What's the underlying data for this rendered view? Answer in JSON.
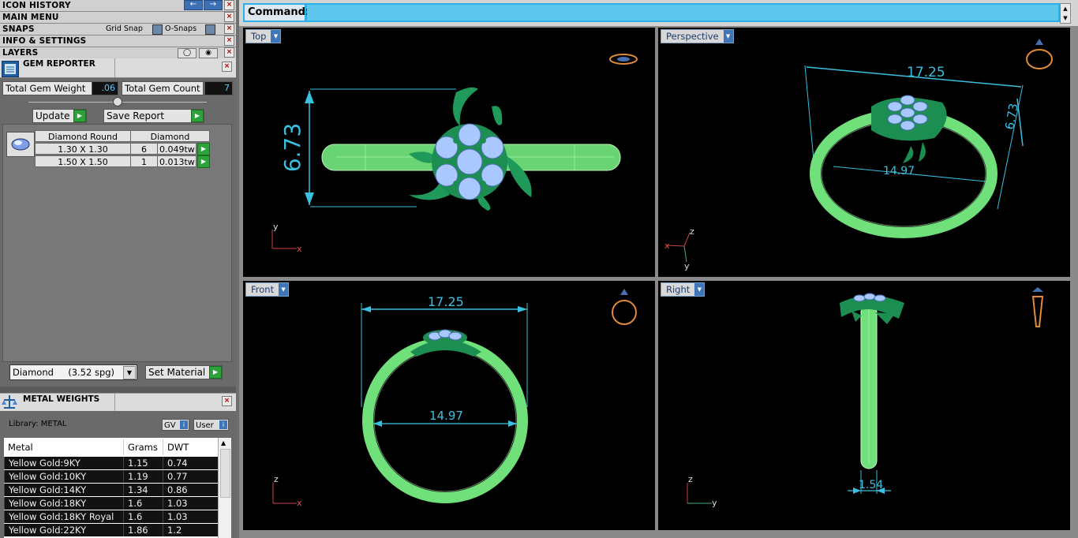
{
  "left_panel": {
    "menus": [
      {
        "label": "ICON HISTORY"
      },
      {
        "label": "MAIN MENU"
      },
      {
        "label": "SNAPS"
      },
      {
        "label": "INFO & SETTINGS"
      },
      {
        "label": "LAYERS"
      }
    ],
    "snaps": {
      "grid_snap": "Grid Snap",
      "o_snaps": "O-Snaps"
    },
    "gem_reporter": {
      "title": "GEM REPORTER",
      "total_weight_label": "Total Gem Weight",
      "total_weight_value": ".06",
      "total_count_label": "Total Gem Count",
      "total_count_value": "7",
      "update_label": "Update",
      "save_report_label": "Save Report",
      "table_header": {
        "shape": "Diamond Round",
        "material": "Diamond"
      },
      "rows": [
        {
          "size": "1.30 X 1.30",
          "count": "6",
          "weight": "0.049tw"
        },
        {
          "size": "1.50 X 1.50",
          "count": "1",
          "weight": "0.013tw"
        }
      ],
      "material_select": "Diamond     (3.52 spg)",
      "set_material_label": "Set Material"
    },
    "metal_weights": {
      "title": "METAL WEIGHTS",
      "library": "Library: METAL",
      "gv_label": "GV",
      "user_label": "User",
      "columns": [
        "Metal",
        "Grams",
        "DWT"
      ],
      "rows": [
        {
          "metal": "Yellow Gold:9KY",
          "grams": "1.15",
          "dwt": "0.74"
        },
        {
          "metal": "Yellow Gold:10KY",
          "grams": "1.19",
          "dwt": "0.77"
        },
        {
          "metal": "Yellow Gold:14KY",
          "grams": "1.34",
          "dwt": "0.86"
        },
        {
          "metal": "Yellow Gold:18KY",
          "grams": "1.6",
          "dwt": "1.03"
        },
        {
          "metal": "Yellow Gold:18KY Royal",
          "grams": "1.6",
          "dwt": "1.03"
        },
        {
          "metal": "Yellow Gold:22KY",
          "grams": "1.86",
          "dwt": "1.2"
        }
      ]
    }
  },
  "command": {
    "label": "Command:",
    "value": ""
  },
  "viewports": {
    "top": {
      "label": "Top",
      "dim_vertical": "6.73",
      "axis_x": "x",
      "axis_y": "y"
    },
    "perspective": {
      "label": "Perspective",
      "dim_top": "17.25",
      "dim_side": "6.73",
      "dim_inner": "14.97",
      "axis_x": "x",
      "axis_y": "y",
      "axis_z": "z"
    },
    "front": {
      "label": "Front",
      "dim_top": "17.25",
      "dim_inner": "14.97",
      "axis_x": "x",
      "axis_z": "z"
    },
    "right": {
      "label": "Right",
      "dim_width": "1.54",
      "axis_y": "y",
      "axis_z": "z"
    }
  },
  "colors": {
    "ring_green": "#7ef07a",
    "gem_blue": "#a9c8ff",
    "leaf_green": "#1f9a5a",
    "dim_cyan": "#39c0e0",
    "command_blue": "#2ab2e8"
  }
}
